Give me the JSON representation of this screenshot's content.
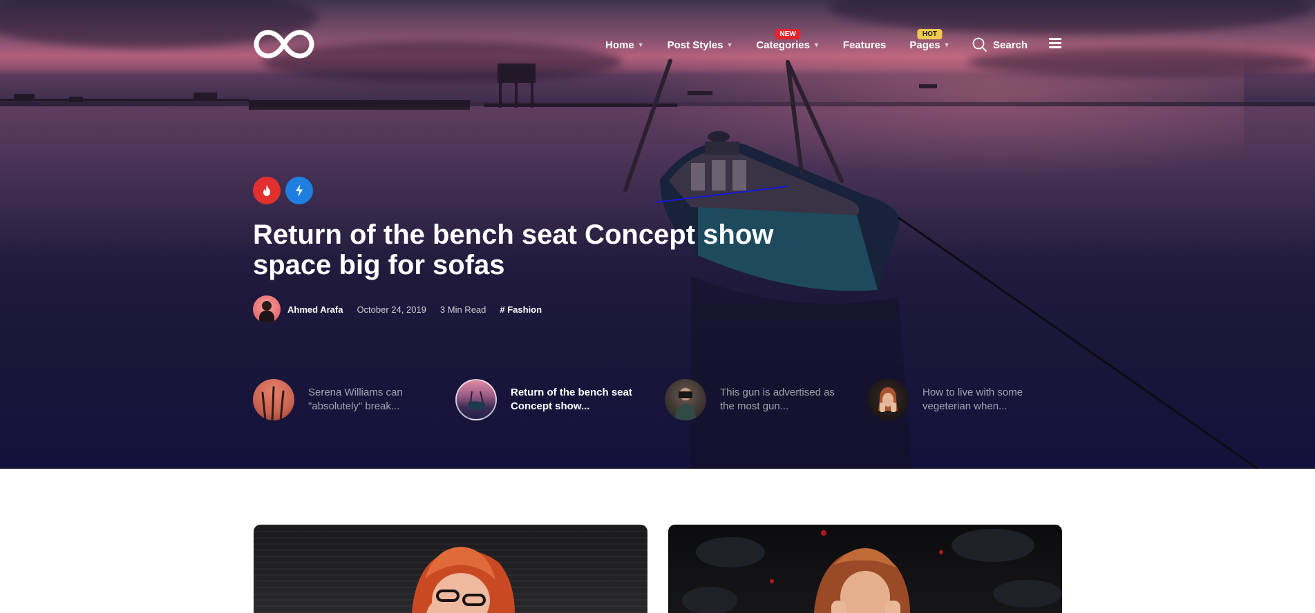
{
  "brand": {
    "logo_icon": "infinity-logo-icon"
  },
  "nav": {
    "items": [
      {
        "label": "Home",
        "has_caret": true,
        "badge": null
      },
      {
        "label": "Post Styles",
        "has_caret": true,
        "badge": null
      },
      {
        "label": "Categories",
        "has_caret": true,
        "badge": "NEW"
      },
      {
        "label": "Features",
        "has_caret": false,
        "badge": null
      },
      {
        "label": "Pages",
        "has_caret": true,
        "badge": "HOT"
      }
    ],
    "search_label": "Search",
    "menu_icon": "hamburger-menu-icon"
  },
  "hero": {
    "category_icons": [
      {
        "icon": "fire-icon",
        "color": "#e2302f"
      },
      {
        "icon": "lightning-icon",
        "color": "#1e7fe0"
      }
    ],
    "title": "Return of the bench seat Concept show space big for sofas",
    "meta": {
      "author": "Ahmed Arafa",
      "date": "October 24, 2019",
      "read_time": "3 Min Read",
      "category": "# Fashion"
    }
  },
  "related": [
    {
      "text": "Serena Williams can \"absolutely\" break...",
      "active": false
    },
    {
      "text": "Return of the bench seat Concept show...",
      "active": true
    },
    {
      "text": "This gun is advertised as the most gun...",
      "active": false
    },
    {
      "text": "How to live with some vegeterian when...",
      "active": false
    }
  ],
  "colors": {
    "badge_new": "#e2252d",
    "badge_hot": "#f2c94c",
    "hero_bg": "#1f1a3c"
  }
}
